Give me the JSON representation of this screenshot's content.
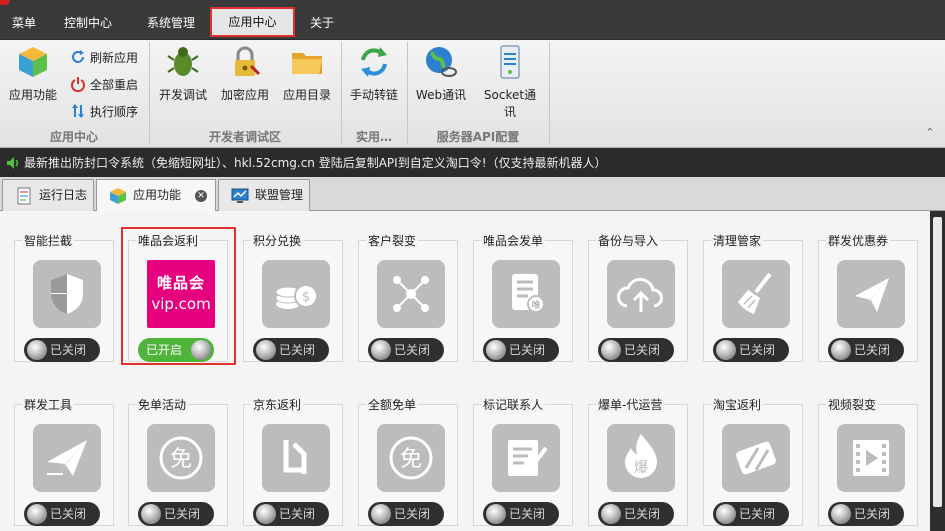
{
  "menu": {
    "items": [
      "菜单",
      "控制中心",
      "系统管理",
      "应用中心",
      "关于"
    ],
    "active": "应用中心"
  },
  "ribbon": {
    "app_center": {
      "label": "应用中心",
      "big": "应用功能",
      "small": [
        "刷新应用",
        "全部重启",
        "执行顺序"
      ]
    },
    "dev": {
      "label": "开发者调试区",
      "buttons": [
        "开发调试",
        "加密应用",
        "应用目录"
      ]
    },
    "practical": {
      "label": "实用…",
      "buttons": [
        "手动转链"
      ]
    },
    "server": {
      "label": "服务器API配置",
      "buttons": [
        "Web通讯",
        "Socket通讯"
      ]
    }
  },
  "notice": "最新推出防封口令系统（免缩短网址）、hkl.52cmg.cn 登陆后复制API到自定义淘口令!（仅支持最新机器人）",
  "tabs": [
    {
      "label": "运行日志",
      "icon": "log-icon"
    },
    {
      "label": "应用功能",
      "icon": "cube-icon",
      "active": true
    },
    {
      "label": "联盟管理",
      "icon": "monitor-icon"
    }
  ],
  "toggle_text": {
    "off": "已关闭",
    "on": "已开启"
  },
  "vip_logo": {
    "line1": "唯品会",
    "line2": "vip.com"
  },
  "apps": [
    {
      "title": "智能拦截",
      "icon": "shield-icon",
      "on": false
    },
    {
      "title": "唯品会返利",
      "icon": "vip-logo",
      "on": true
    },
    {
      "title": "积分兑换",
      "icon": "coins-icon",
      "on": false
    },
    {
      "title": "客户裂变",
      "icon": "share-network-icon",
      "on": false
    },
    {
      "title": "唯品会发单",
      "icon": "document-vip-icon",
      "on": false
    },
    {
      "title": "备份与导入",
      "icon": "cloud-upload-icon",
      "on": false
    },
    {
      "title": "清理管家",
      "icon": "broom-icon",
      "on": false
    },
    {
      "title": "群发优惠券",
      "icon": "paper-plane-icon",
      "on": false
    },
    {
      "title": "群发工具",
      "icon": "send-plane-icon",
      "on": false
    },
    {
      "title": "免单活动",
      "icon": "free-badge-icon",
      "on": false
    },
    {
      "title": "京东返利",
      "icon": "jd-icon",
      "on": false
    },
    {
      "title": "全额免单",
      "icon": "free-badge-icon",
      "on": false
    },
    {
      "title": "标记联系人",
      "icon": "edit-note-icon",
      "on": false
    },
    {
      "title": "爆单-代运营",
      "icon": "fire-icon",
      "on": false
    },
    {
      "title": "淘宝返利",
      "icon": "taobao-icon",
      "on": false
    },
    {
      "title": "视频裂变",
      "icon": "film-icon",
      "on": false
    }
  ]
}
